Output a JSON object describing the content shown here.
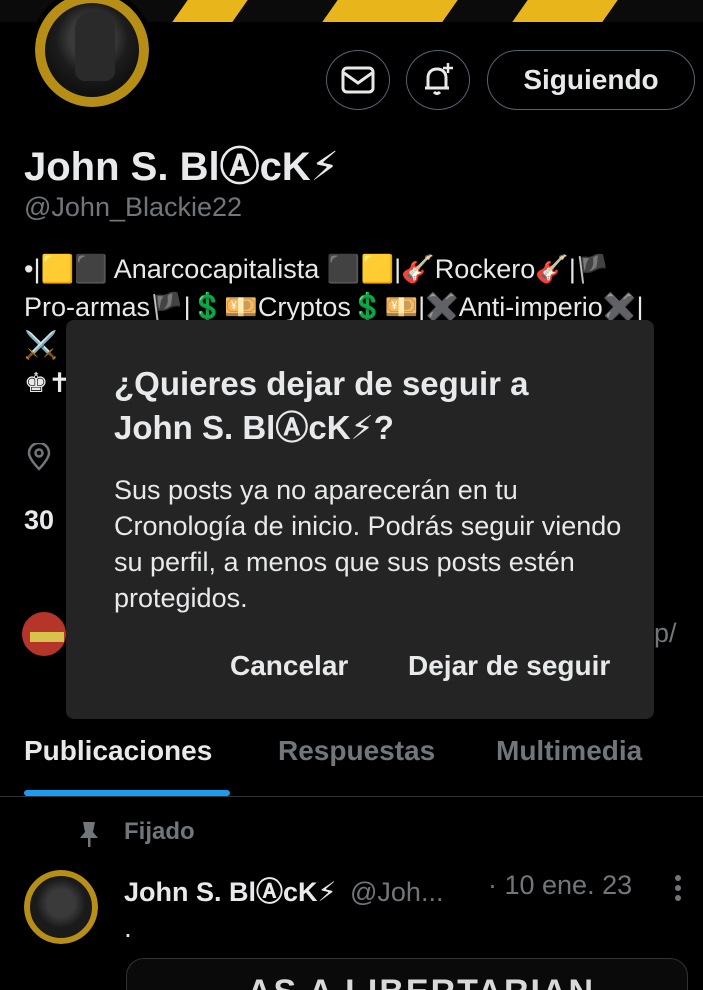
{
  "profile": {
    "name": "John S. BlⒶcK⚡",
    "handle": "@John_Blackie22",
    "bio_lines": [
      "•|🟨⬛ Anarcocapitalista ⬛🟨|🎸Rockero🎸|🏴",
      "Pro-armas🏴|💲💴Cryptos💲💴|✖️Anti-imperio✖️|",
      "⚔️",
      "♚✝"
    ],
    "stat_fragment": "30",
    "link_fragment": "p/"
  },
  "header": {
    "follow_button_label": "Siguiendo",
    "message_icon": "mail-icon",
    "notify_icon": "bell-plus-icon"
  },
  "tabs": [
    {
      "label": "Publicaciones",
      "active": true
    },
    {
      "label": "Respuestas",
      "active": false
    },
    {
      "label": "Multimedia",
      "active": false
    }
  ],
  "pinned_post": {
    "pinned_label": "Fijado",
    "author_name": "John S. BlⒶcK⚡",
    "author_handle": "@Joh...",
    "time": "· 10 ene. 23",
    "text": ".",
    "card_text": "AS A LIBERTARIAN"
  },
  "dialog": {
    "title": "¿Quieres dejar de seguir a John S. BlⒶcK⚡?",
    "body": "Sus posts ya no aparecerán en tu Cronología de inicio. Podrás seguir viendo su perfil, a menos que sus posts estén protegidos.",
    "cancel_label": "Cancelar",
    "confirm_label": "Dejar de seguir"
  },
  "colors": {
    "background": "#000000",
    "dialog_bg": "#242424",
    "accent_blue": "#1d9bf0",
    "muted_text": "#71767b",
    "banner_gold": "#e8b61a"
  }
}
